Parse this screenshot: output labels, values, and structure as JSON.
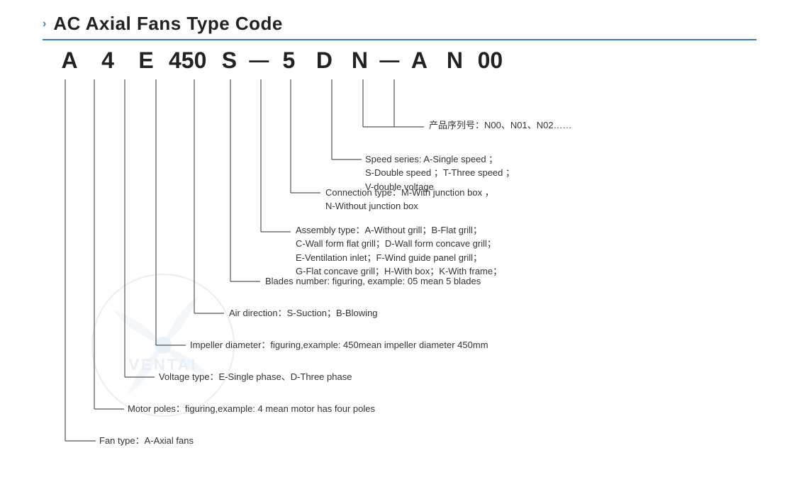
{
  "title": {
    "chevron": "›",
    "text": "AC Axial Fans Type Code",
    "underline": true
  },
  "code": {
    "letters": [
      "A",
      "4",
      "E",
      "450",
      "S",
      "—",
      "5",
      "D",
      "N",
      "—",
      "A",
      "N",
      "00"
    ]
  },
  "descriptions": [
    {
      "id": "product-series",
      "text": "产品序列号：N00、N01、N02……"
    },
    {
      "id": "speed-series",
      "text": "Speed series:  A-Single speed ；\nS-Double speed ；T-Three speed ；\nV-double voltage"
    },
    {
      "id": "connection-type",
      "text": "Connection type：M-With junction box ，\nN-Without junction box"
    },
    {
      "id": "assembly-type",
      "text": "Assembly type：A-Without grill；B-Flat grill；\nC-Wall form flat grill；D-Wall form concave grill；\nE-Ventilation inlet；F-Wind guide panel grill；\nG-Flat concave grill；H-With box；K-With frame；"
    },
    {
      "id": "blades-number",
      "text": "Blades number: figuring, example: 05 mean 5 blades"
    },
    {
      "id": "air-direction",
      "text": "Air direction：S-Suction；B-Blowing"
    },
    {
      "id": "impeller-diameter",
      "text": "Impeller diameter：figuring,example: 450mean impeller diameter 450mm"
    },
    {
      "id": "voltage-type",
      "text": "Voltage type：E-Single phase、D-Three phase"
    },
    {
      "id": "motor-poles",
      "text": "Motor poles：figuring,example: 4 mean motor has four poles"
    },
    {
      "id": "fan-type",
      "text": "Fan type：A-Axial fans"
    }
  ]
}
